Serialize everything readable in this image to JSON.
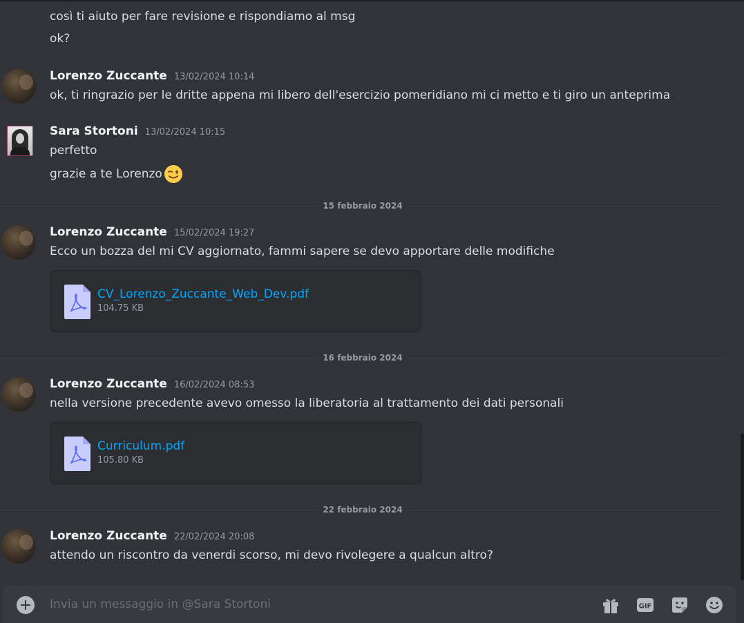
{
  "conversation": {
    "top_partial_lines": [
      "così ti aiuto per fare revisione e rispondiamo al msg",
      "ok?"
    ],
    "messages": [
      {
        "author": "Lorenzo Zuccante",
        "timestamp": "13/02/2024 10:14",
        "lines": [
          "ok, ti ringrazio per le dritte appena mi libero dell'esercizio pomeridiano mi ci metto e ti giro un anteprima"
        ]
      },
      {
        "author": "Sara Stortoni",
        "timestamp": "13/02/2024 10:15",
        "lines": [
          "perfetto",
          "grazie a te Lorenzo"
        ],
        "emoji": "winking-face"
      },
      {
        "author": "Lorenzo Zuccante",
        "timestamp": "15/02/2024 19:27",
        "lines": [
          "Ecco un bozza del mi CV aggiornato, fammi sapere se devo apportare delle modifiche"
        ],
        "attachment": {
          "name": "CV_Lorenzo_Zuccante_Web_Dev.pdf",
          "size": "104.75 KB",
          "icon": "pdf-file-icon"
        }
      },
      {
        "author": "Lorenzo Zuccante",
        "timestamp": "16/02/2024 08:53",
        "lines": [
          "nella versione precedente avevo omesso la liberatoria al trattamento dei dati personali"
        ],
        "attachment": {
          "name": "Curriculum.pdf",
          "size": "105.80 KB",
          "icon": "pdf-file-icon"
        }
      },
      {
        "author": "Lorenzo Zuccante",
        "timestamp": "22/02/2024 20:08",
        "lines": [
          "attendo un riscontro da venerdi scorso, mi devo rivolegere a qualcun altro?"
        ]
      }
    ],
    "dividers": [
      "15 febbraio 2024",
      "16 febbraio 2024",
      "22 febbraio 2024"
    ]
  },
  "composer": {
    "placeholder": "Invia un messaggio in @Sara Stortoni",
    "gif_label": "GIF",
    "icons": [
      "add-attachment-icon",
      "gift-icon",
      "gif-icon",
      "sticker-icon",
      "emoji-icon"
    ]
  },
  "colors": {
    "background": "#313338",
    "link": "#00a8fc",
    "composer": "#383a40",
    "attachment_bg": "#2b2d31"
  }
}
